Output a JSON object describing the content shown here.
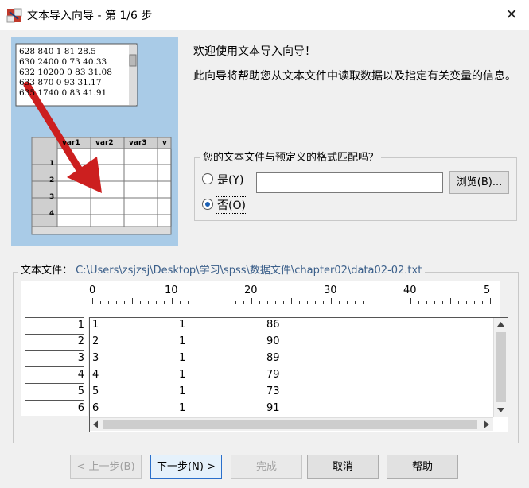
{
  "window": {
    "title": "文本导入向导 - 第 1/6 步",
    "close_glyph": "✕"
  },
  "illustration": {
    "text_lines": [
      "628 840 1 81 28.5",
      "630 2400 0 73 40.33",
      "632 10200 0 83 31.08",
      "633 870 0 93 31.17",
      "635 1740 0 83 41.91"
    ],
    "grid_headers": [
      "var1",
      "var2",
      "var3",
      "v"
    ],
    "grid_rows": [
      "1",
      "2",
      "3",
      "4"
    ]
  },
  "welcome": {
    "title": "欢迎使用文本导入向导！",
    "description": "此向导将帮助您从文本文件中读取数据以及指定有关变量的信息。"
  },
  "format_group": {
    "label": "您的文本文件与预定义的格式匹配吗？",
    "yes_label": "是(Y)",
    "no_label": "否(O)",
    "selected": "no",
    "path_value": "",
    "browse_label": "浏览(B)..."
  },
  "file": {
    "label": "文本文件：",
    "path": "C:\\Users\\zsjzsj\\Desktop\\学习\\spss\\数据文件\\chapter02\\data02-02.txt",
    "ruler_labels": [
      "0",
      "10",
      "20",
      "30",
      "40",
      "5"
    ],
    "row_numbers": [
      "1",
      "2",
      "3",
      "4",
      "5",
      "6"
    ],
    "rows": [
      [
        "1",
        "1",
        "86"
      ],
      [
        "2",
        "1",
        "90"
      ],
      [
        "3",
        "1",
        "89"
      ],
      [
        "4",
        "1",
        "79"
      ],
      [
        "5",
        "1",
        "73"
      ],
      [
        "6",
        "1",
        "91"
      ]
    ]
  },
  "buttons": {
    "back": "< 上一步(B)",
    "next": "下一步(N) >",
    "finish": "完成",
    "cancel": "取消",
    "help": "帮助"
  },
  "colors": {
    "illustration_bg": "#a9cbe7",
    "arrow": "#cc1f1f",
    "accent": "#2a6fcb"
  }
}
